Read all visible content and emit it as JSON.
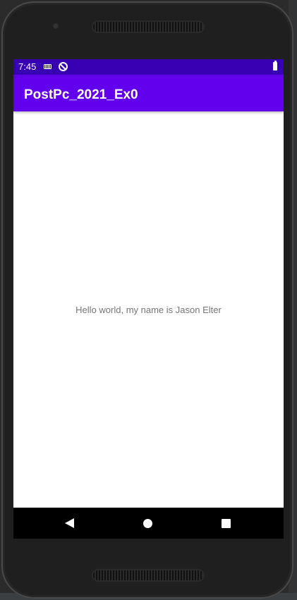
{
  "status_bar": {
    "time": "7:45",
    "icons": [
      "keyboard-icon",
      "do-not-disturb-icon",
      "battery-icon"
    ]
  },
  "app_bar": {
    "title": "PostPc_2021_Ex0"
  },
  "main": {
    "greeting": "Hello world, my name is Jason Elter"
  },
  "nav_bar": {
    "icons": [
      "back-icon",
      "home-icon",
      "recents-icon"
    ]
  },
  "colors": {
    "status_bar": "#3700b3",
    "app_bar": "#6200ee",
    "background": "#ffffff",
    "text_secondary": "#757575",
    "nav_bar": "#000000"
  }
}
